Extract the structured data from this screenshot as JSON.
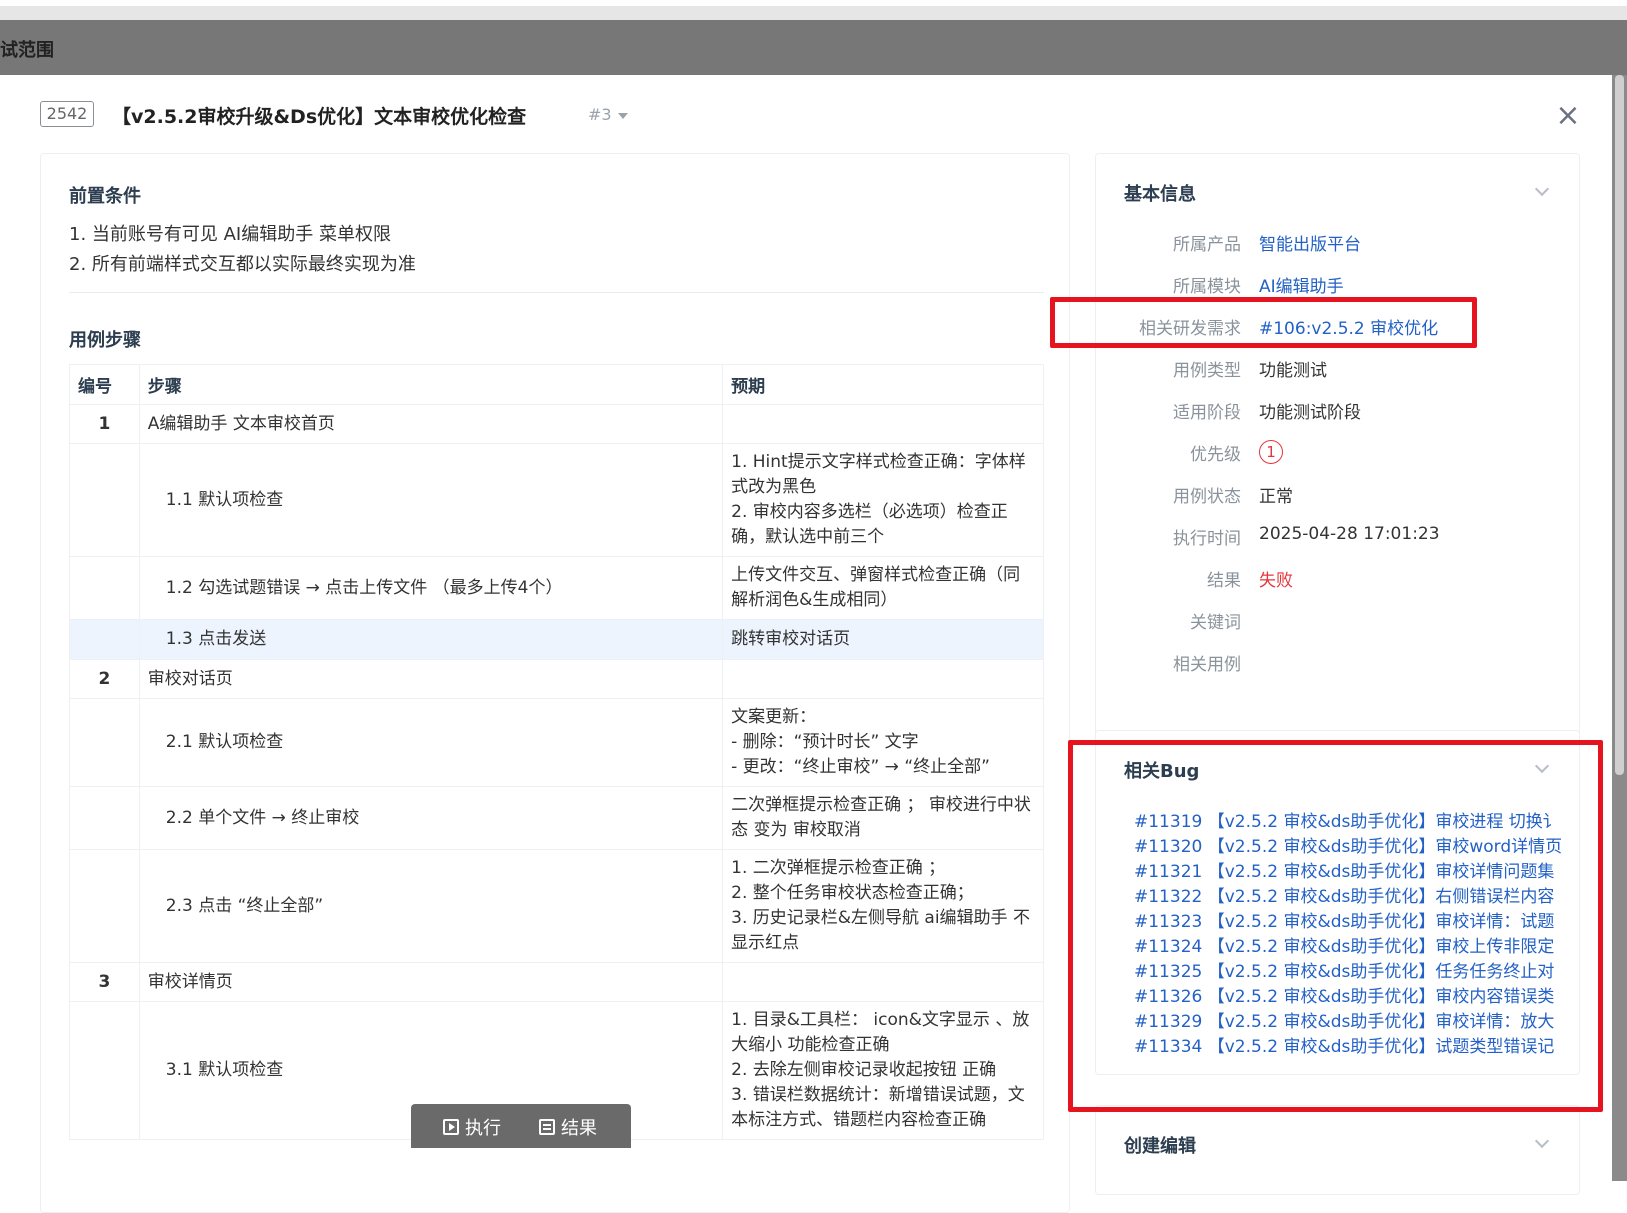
{
  "backdrop": {
    "title": "试范围"
  },
  "header": {
    "case_id": "2542",
    "title": "【v2.5.2审校升级&Ds优化】文本审校优化检查",
    "version": "#3",
    "close_symbol": "×"
  },
  "precondition": {
    "title": "前置条件",
    "items": [
      "1. 当前账号有可见 AI编辑助手 菜单权限",
      "2. 所有前端样式交互都以实际最终实现为准"
    ]
  },
  "steps": {
    "title": "用例步骤",
    "headers": [
      "编号",
      "步骤",
      "预期"
    ],
    "rows": [
      {
        "num": "1",
        "step": "A编辑助手 文本审校首页",
        "expect": ""
      },
      {
        "num": "",
        "step": "1.1  默认项检查",
        "expect": "1. Hint提示文字样式检查正确：字体样式改为黑色\n2. 审校内容多选栏（必选项）检查正确，默认选中前三个"
      },
      {
        "num": "",
        "step": "1.2  勾选试题错误 → 点击上传文件 （最多上传4个）",
        "expect": "上传文件交互、弹窗样式检查正确（同解析润色&生成相同）"
      },
      {
        "num": "",
        "step": "1.3  点击发送",
        "expect": "跳转审校对话页"
      },
      {
        "num": "2",
        "step": "审校对话页",
        "expect": ""
      },
      {
        "num": "",
        "step": "2.1  默认项检查",
        "expect": "文案更新：\n- 删除：“预计时长” 文字\n- 更改：“终止审校” → “终止全部”"
      },
      {
        "num": "",
        "step": "2.2  单个文件 → 终止审校",
        "expect": "二次弹框提示检查正确 ； 审校进行中状态 变为 审校取消"
      },
      {
        "num": "",
        "step": "2.3  点击 “终止全部”",
        "expect": "1. 二次弹框提示检查正确 ；\n2. 整个任务审校状态检查正确；\n3. 历史记录栏&左侧导航 ai编辑助手 不显示红点"
      },
      {
        "num": "3",
        "step": "审校详情页",
        "expect": ""
      },
      {
        "num": "",
        "step": "3.1  默认项检查",
        "expect": "1. 目录&工具栏： icon&文字显示 、放大缩小 功能检查正确\n2. 去除左侧审校记录收起按钮 正确\n3. 错误栏数据统计：新增错误试题，文本标注方式、错题栏内容检查正确"
      }
    ]
  },
  "actions": {
    "execute": "执行",
    "result": "结果"
  },
  "basic_info": {
    "title": "基本信息",
    "rows": [
      {
        "label": "所属产品",
        "value": "智能出版平台"
      },
      {
        "label": "所属模块",
        "value": "AI编辑助手"
      },
      {
        "label": "相关研发需求",
        "value": "#106:v2.5.2 审校优化"
      },
      {
        "label": "用例类型",
        "value": "功能测试"
      },
      {
        "label": "适用阶段",
        "value": "功能测试阶段"
      },
      {
        "label": "优先级",
        "value": "1"
      },
      {
        "label": "用例状态",
        "value": "正常"
      },
      {
        "label": "执行时间",
        "value": "2025-04-28 17:01:23"
      },
      {
        "label": "结果",
        "value": "失败"
      },
      {
        "label": "关键词",
        "value": ""
      },
      {
        "label": "相关用例",
        "value": ""
      }
    ]
  },
  "related_bugs": {
    "title": "相关Bug",
    "items": [
      "#11319 【v2.5.2 审校&ds助手优化】审校进程 切换讠",
      "#11320 【v2.5.2 审校&ds助手优化】审校word详情页",
      "#11321 【v2.5.2 审校&ds助手优化】审校详情问题集",
      "#11322 【v2.5.2 审校&ds助手优化】右侧错误栏内容",
      "#11323 【v2.5.2 审校&ds助手优化】审校详情：试题",
      "#11324 【v2.5.2 审校&ds助手优化】审校上传非限定",
      "#11325 【v2.5.2 审校&ds助手优化】任务任务终止对",
      "#11326 【v2.5.2 审校&ds助手优化】审校内容错误类",
      "#11329 【v2.5.2 审校&ds助手优化】审校详情：放大",
      "#11334 【v2.5.2 审校&ds助手优化】试题类型错误记"
    ]
  },
  "create_edit": {
    "title": "创建编辑"
  },
  "colors": {
    "link": "#2361c6",
    "fail": "#e5353b",
    "highlight": "#e5141f"
  }
}
